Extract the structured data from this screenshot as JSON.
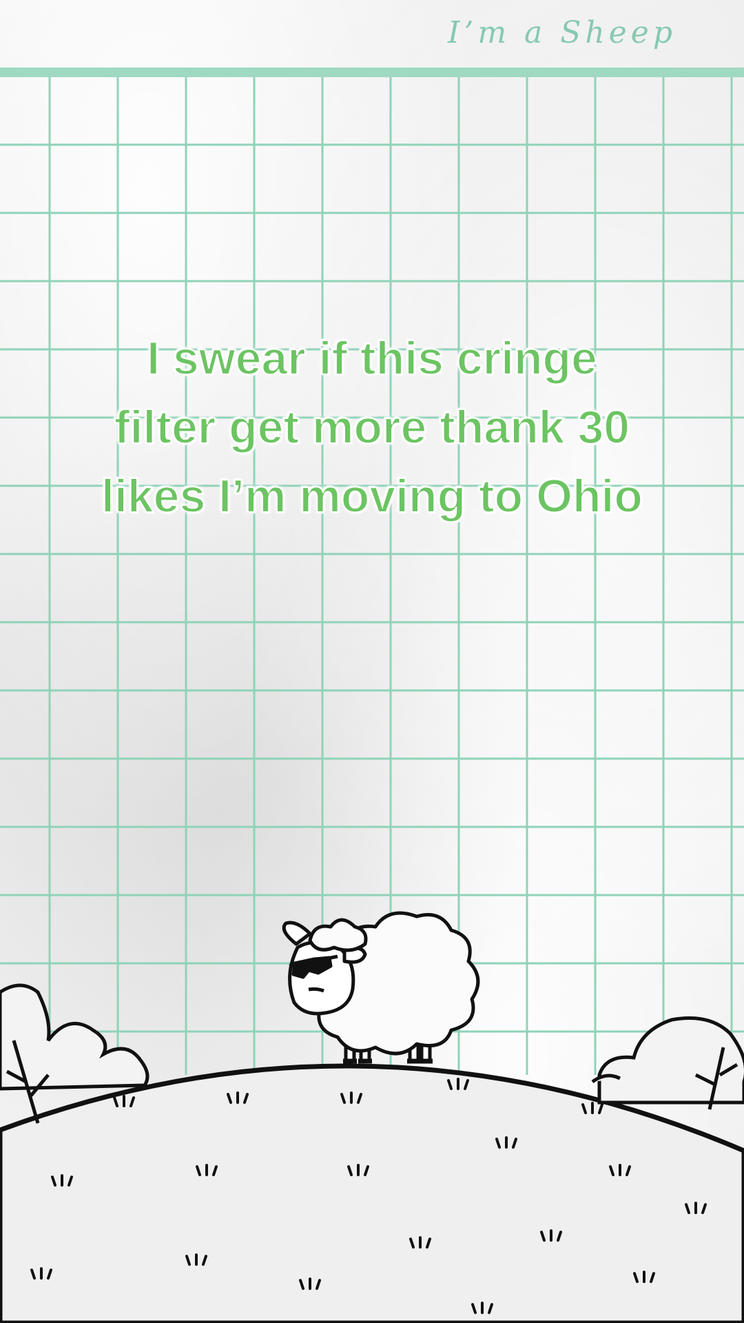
{
  "header": {
    "title": "I’m a Sheep"
  },
  "caption": {
    "lines": [
      "I swear if this cringe",
      "filter get more thank 30",
      "likes I’m moving to Ohio"
    ]
  },
  "colors": {
    "grid_line": "#8fd3b8",
    "caption_fill": "#6cc462",
    "caption_outline": "#ffffff",
    "title": "#86c9b0",
    "ink": "#111111"
  },
  "icons": {
    "character": "sheep-with-sunglasses-icon",
    "trees": "tree-icon",
    "grass": "grass-tuft-icon"
  }
}
